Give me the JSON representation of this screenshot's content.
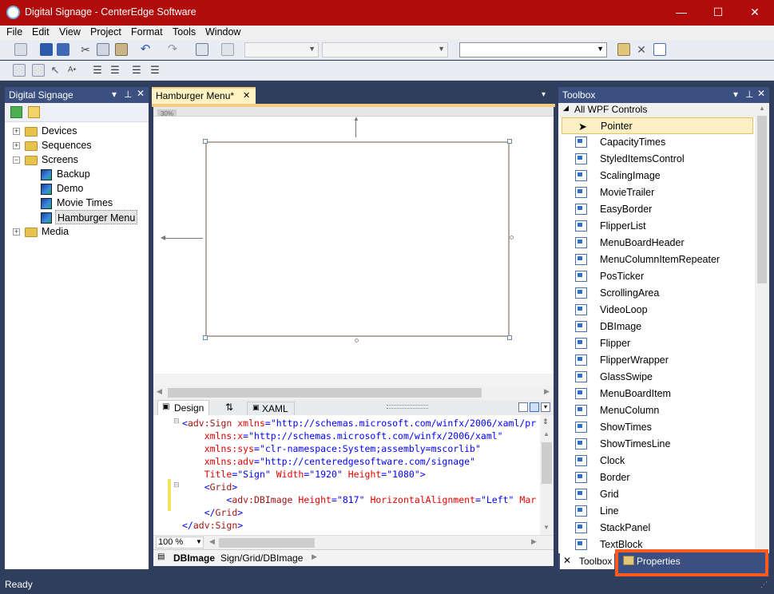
{
  "window": {
    "title": "Digital Signage - CenterEdge Software",
    "minimize": "—",
    "maximize": "☐",
    "close": "✕"
  },
  "menubar": [
    "File",
    "Edit",
    "View",
    "Project",
    "Format",
    "Tools",
    "Window"
  ],
  "left_panel": {
    "title": "Digital Signage",
    "tree": [
      {
        "label": "Devices",
        "type": "folder",
        "expander": "+"
      },
      {
        "label": "Sequences",
        "type": "folder",
        "expander": "+"
      },
      {
        "label": "Screens",
        "type": "folder",
        "expander": "−"
      },
      {
        "label": "Backup",
        "type": "screen"
      },
      {
        "label": "Demo",
        "type": "screen"
      },
      {
        "label": "Movie Times",
        "type": "screen"
      },
      {
        "label": "Hamburger Menu",
        "type": "screen",
        "selected": true
      },
      {
        "label": "Media",
        "type": "folder",
        "expander": "+"
      }
    ]
  },
  "document_tab": {
    "label": "Hamburger Menu*",
    "close": "✕",
    "zoom_badge": "30%"
  },
  "bottom_tabs": {
    "design": "Design",
    "swap": "⇅",
    "xaml": "XAML"
  },
  "xaml_lines": [
    [
      [
        "t-punc",
        "<"
      ],
      [
        "t-tag",
        "adv:Sign"
      ],
      [
        "t-attr",
        " xmlns"
      ],
      [
        "t-punc",
        "="
      ],
      [
        "t-val",
        "\"http://schemas.microsoft.com/winfx/2006/xaml/pr"
      ]
    ],
    [
      [
        "t-attr",
        "    xmlns:x"
      ],
      [
        "t-punc",
        "="
      ],
      [
        "t-val",
        "\"http://schemas.microsoft.com/winfx/2006/xaml\""
      ]
    ],
    [
      [
        "t-attr",
        "    xmlns:sys"
      ],
      [
        "t-punc",
        "="
      ],
      [
        "t-val",
        "\"clr-namespace:System;assembly=mscorlib\""
      ]
    ],
    [
      [
        "t-attr",
        "    xmlns:adv"
      ],
      [
        "t-punc",
        "="
      ],
      [
        "t-val",
        "\"http://centeredgesoftware.com/signage\""
      ]
    ],
    [
      [
        "t-attr",
        "    Title"
      ],
      [
        "t-punc",
        "="
      ],
      [
        "t-val",
        "\"Sign\""
      ],
      [
        "t-attr",
        " Width"
      ],
      [
        "t-punc",
        "="
      ],
      [
        "t-val",
        "\"1920\""
      ],
      [
        "t-attr",
        " Height"
      ],
      [
        "t-punc",
        "="
      ],
      [
        "t-val",
        "\"1080\""
      ],
      [
        "t-punc",
        ">"
      ]
    ],
    [
      [
        "t-punc",
        "    <"
      ],
      [
        "t-tag",
        "Grid"
      ],
      [
        "t-punc",
        ">"
      ]
    ],
    [
      [
        "t-punc",
        "        <"
      ],
      [
        "t-tag",
        "adv:DBImage"
      ],
      [
        "t-attr",
        " Height"
      ],
      [
        "t-punc",
        "="
      ],
      [
        "t-val",
        "\"817\""
      ],
      [
        "t-attr",
        " HorizontalAlignment"
      ],
      [
        "t-punc",
        "="
      ],
      [
        "t-val",
        "\"Left\""
      ],
      [
        "t-attr",
        " Mar"
      ]
    ],
    [
      [
        "t-punc",
        "    </"
      ],
      [
        "t-tag",
        "Grid"
      ],
      [
        "t-punc",
        ">"
      ]
    ],
    [
      [
        "t-punc",
        "</"
      ],
      [
        "t-tag",
        "adv:Sign"
      ],
      [
        "t-punc",
        ">"
      ]
    ]
  ],
  "editor_status": {
    "zoom": "100 %",
    "crumb_bold": "DBImage",
    "crumb_path": "Sign/Grid/DBImage"
  },
  "toolbox": {
    "title": "Toolbox",
    "group": "All WPF Controls",
    "items": [
      "Pointer",
      "CapacityTimes",
      "StyledItemsControl",
      "ScalingImage",
      "MovieTrailer",
      "EasyBorder",
      "FlipperList",
      "MenuBoardHeader",
      "MenuColumnItemRepeater",
      "PosTicker",
      "ScrollingArea",
      "VideoLoop",
      "DBImage",
      "Flipper",
      "FlipperWrapper",
      "GlassSwipe",
      "MenuBoardItem",
      "MenuColumn",
      "ShowTimes",
      "ShowTimesLine",
      "Clock",
      "Border",
      "Grid",
      "Line",
      "StackPanel",
      "TextBlock"
    ]
  },
  "bottom_right_tabs": {
    "toolbox": "Toolbox",
    "properties": "Properties"
  },
  "statusbar": {
    "text": "Ready"
  },
  "colors": {
    "titlebar": "#b10b0b",
    "panel_header": "#3b4f81",
    "highlight": "#ff5a1f",
    "selected_tool": "#fcefc3"
  }
}
